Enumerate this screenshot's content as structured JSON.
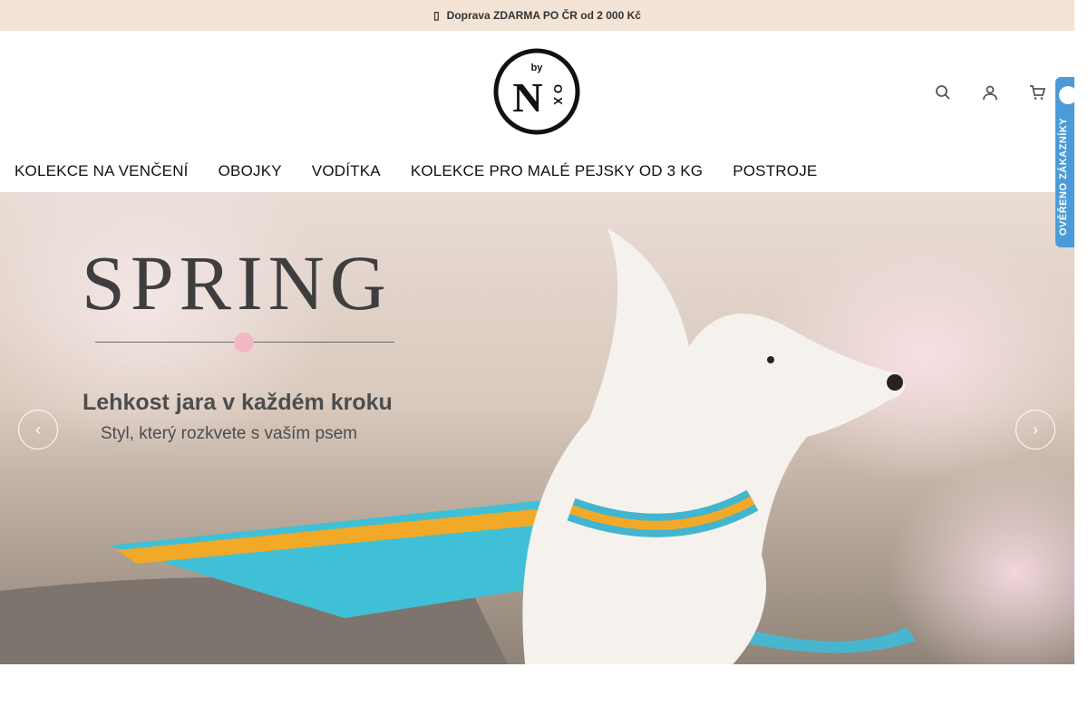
{
  "topbar": {
    "text": "Doprava ZDARMA PO ČR od 2 000 Kč",
    "icon": "truck-icon"
  },
  "header": {
    "logo": {
      "top_text": "by",
      "letters": [
        "N",
        "O",
        "X"
      ]
    },
    "icons": [
      "search-icon",
      "user-icon",
      "cart-icon"
    ]
  },
  "nav": {
    "items": [
      "KOLEKCE NA VENČENÍ",
      "OBOJKY",
      "VODÍTKA",
      "KOLEKCE PRO MALÉ PEJSKY OD 3 KG",
      "POSTROJE"
    ]
  },
  "hero": {
    "title": "SPRING",
    "headline": "Lehkost jara v každém kroku",
    "subheadline": "Styl, který rozkvete s vaším psem",
    "arrows": {
      "prev": "‹",
      "next": "›"
    }
  },
  "badge": {
    "text": "OVĚŘENO ZÁKAZNÍKY",
    "color": "#4a9bd8"
  },
  "colors": {
    "topbar_bg": "#f3e4d7",
    "text": "#111111"
  }
}
